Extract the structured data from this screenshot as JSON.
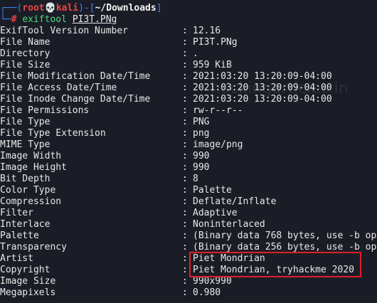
{
  "prompt": {
    "user": "root",
    "skull": "💀",
    "host": "kali",
    "path": "~/Downloads",
    "hash": "#",
    "command": "exiftool",
    "argument": "PI3T.PNg"
  },
  "rows": [
    {
      "key": "ExifTool Version Number",
      "value": "12.16"
    },
    {
      "key": "File Name",
      "value": "PI3T.PNg"
    },
    {
      "key": "Directory",
      "value": "."
    },
    {
      "key": "File Size",
      "value": "959 KiB"
    },
    {
      "key": "File Modification Date/Time",
      "value": "2021:03:20 13:20:09-04:00"
    },
    {
      "key": "File Access Date/Time",
      "value": "2021:03:20 13:20:09-04:00"
    },
    {
      "key": "File Inode Change Date/Time",
      "value": "2021:03:20 13:20:09-04:00"
    },
    {
      "key": "File Permissions",
      "value": "rw-r--r--"
    },
    {
      "key": "File Type",
      "value": "PNG"
    },
    {
      "key": "File Type Extension",
      "value": "png"
    },
    {
      "key": "MIME Type",
      "value": "image/png"
    },
    {
      "key": "Image Width",
      "value": "990"
    },
    {
      "key": "Image Height",
      "value": "990"
    },
    {
      "key": "Bit Depth",
      "value": "8"
    },
    {
      "key": "Color Type",
      "value": "Palette"
    },
    {
      "key": "Compression",
      "value": "Deflate/Inflate"
    },
    {
      "key": "Filter",
      "value": "Adaptive"
    },
    {
      "key": "Interlace",
      "value": "Noninterlaced"
    },
    {
      "key": "Palette",
      "value": "(Binary data 768 bytes, use -b op"
    },
    {
      "key": "Transparency",
      "value": "(Binary data 256 bytes, use -b op"
    },
    {
      "key": "Artist",
      "value": "Piet Mondrian"
    },
    {
      "key": "Copyright",
      "value": "Piet Mondrian, tryhackme 2020"
    },
    {
      "key": "Image Size",
      "value": "990x990"
    },
    {
      "key": "Megapixels",
      "value": "0.980"
    }
  ],
  "separator": ":",
  "watermark": "hackingarticles.in",
  "colors": {
    "background": "#1b1d26",
    "prompt_frame": "#3b82f6",
    "root_user": "#ef4444",
    "command": "#4ade80",
    "highlight_border": "#e11d2a"
  }
}
